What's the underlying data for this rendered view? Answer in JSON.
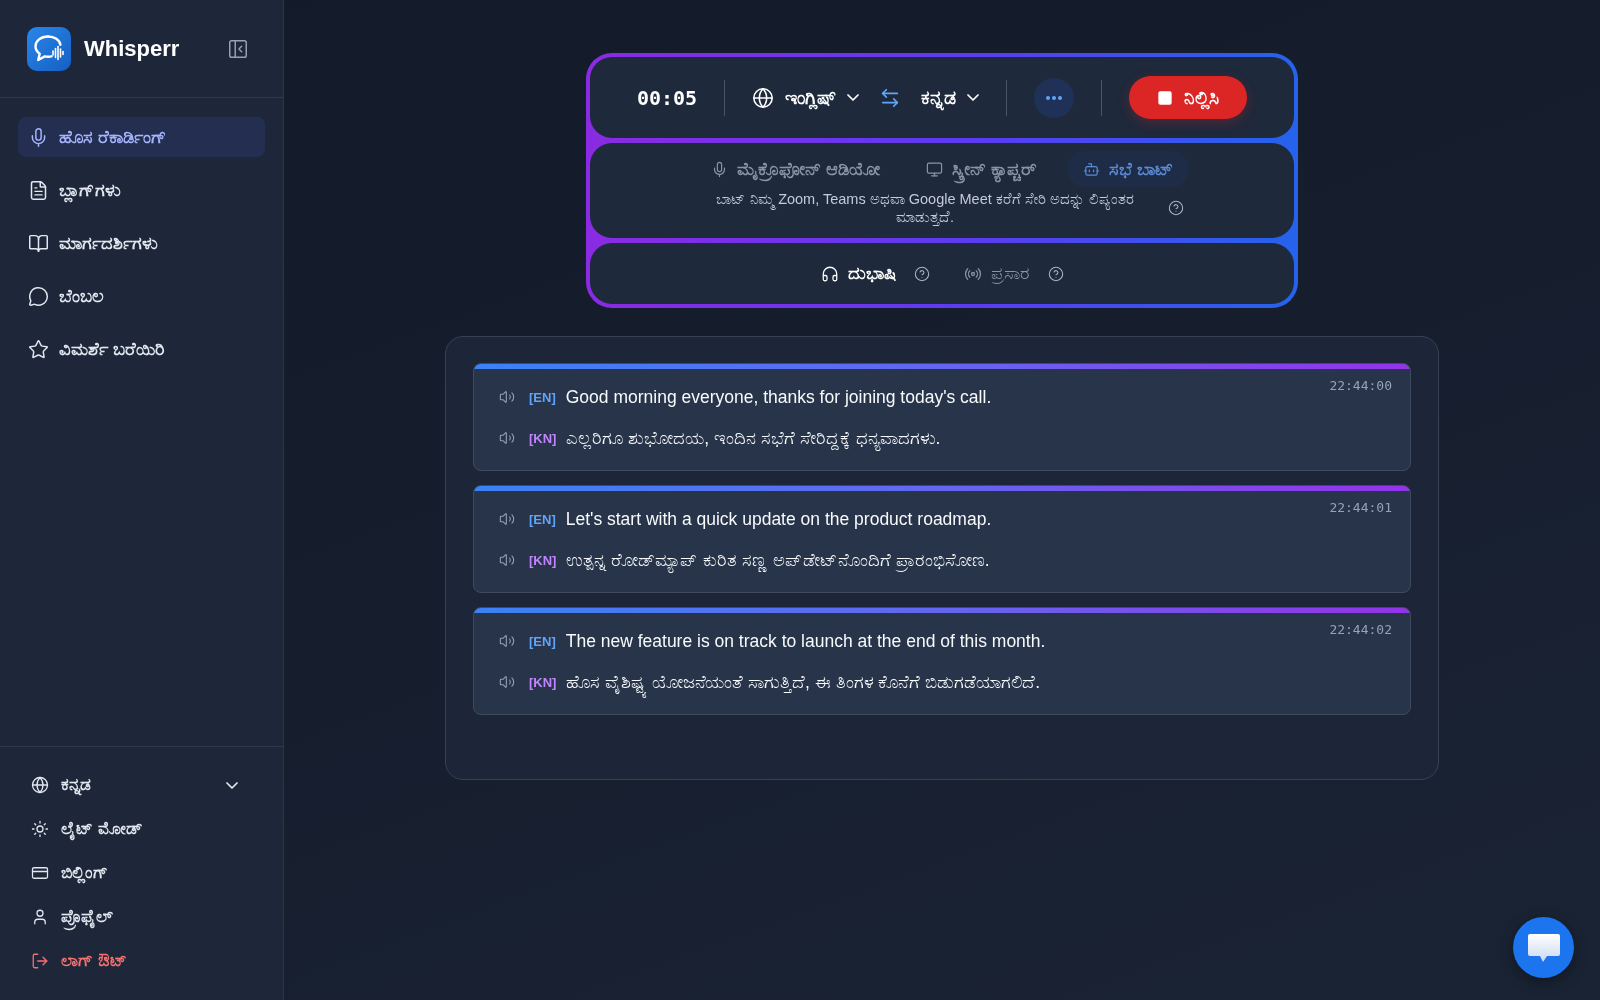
{
  "sidebar": {
    "brand": "Whisperr",
    "nav_items": [
      {
        "label": "ಹೊಸ ರೆಕಾರ್ಡಿಂಗ್",
        "selected": true
      },
      {
        "label": "ಬ್ಲಾಗ್‌ಗಳು",
        "selected": false
      },
      {
        "label": "ಮಾರ್ಗದರ್ಶಿಗಳು",
        "selected": false
      },
      {
        "label": "ಬೆಂಬಲ",
        "selected": false
      },
      {
        "label": "ವಿಮರ್ಶೆ ಬರೆಯಿರಿ",
        "selected": false
      }
    ],
    "footer_items": [
      {
        "label": "ಕನ್ನಡ",
        "kind": "dropdown"
      },
      {
        "label": "ಲೈಟ್ ಮೋಡ್",
        "kind": "link"
      },
      {
        "label": "ಬಿಲ್ಲಿಂಗ್",
        "kind": "link"
      },
      {
        "label": "ಪ್ರೊಫೈಲ್",
        "kind": "link"
      },
      {
        "label": "ಲಾಗ್ ಔಟ್",
        "kind": "danger"
      }
    ]
  },
  "recorder": {
    "timer": "00:05",
    "source_language": "ಇಂಗ್ಲಿಷ್",
    "target_language": "ಕನ್ನಡ",
    "stop_button": "ನಿಲ್ಲಿಸಿ",
    "input_modes": [
      {
        "label": "ಮೈಕ್ರೊಫೋನ್ ಆಡಿಯೋ",
        "selected": false
      },
      {
        "label": "ಸ್ಕ್ರೀನ್ ಕ್ಯಾಪ್ಚರ್",
        "selected": false
      },
      {
        "label": "ಸಭೆ ಬಾಟ್",
        "selected": true
      }
    ],
    "mode_description": "ಬಾಟ್ ನಿಮ್ಮ Zoom, Teams ಅಥವಾ Google Meet ಕರೆಗೆ ಸೇರಿ ಅದನ್ನು ಲಿಪ್ಯಂತರ ಮಾಡುತ್ತದೆ.",
    "output_modes": [
      {
        "label": "ದುಭಾಷಿ",
        "selected": true
      },
      {
        "label": "ಪ್ರಸಾರ",
        "selected": false
      }
    ]
  },
  "transcript": {
    "entries": [
      {
        "time": "22:44:00",
        "lines": [
          {
            "kind": "source",
            "tag": "[EN]",
            "text": "Good morning everyone, thanks for joining today's call."
          },
          {
            "kind": "translation",
            "tag": "[KN]",
            "text": "ಎಲ್ಲರಿಗೂ ಶುಭೋದಯ, ಇಂದಿನ ಸಭೆಗೆ ಸೇರಿದ್ದಕ್ಕೆ ಧನ್ಯವಾದಗಳು."
          }
        ]
      },
      {
        "time": "22:44:01",
        "lines": [
          {
            "kind": "source",
            "tag": "[EN]",
            "text": "Let's start with a quick update on the product roadmap."
          },
          {
            "kind": "translation",
            "tag": "[KN]",
            "text": "ಉತ್ಪನ್ನ ರೋಡ್‌ಮ್ಯಾಪ್ ಕುರಿತ ಸಣ್ಣ ಅಪ್‌ಡೇಟ್‌ನೊಂದಿಗೆ ಪ್ರಾರಂಭಿಸೋಣ."
          }
        ]
      },
      {
        "time": "22:44:02",
        "lines": [
          {
            "kind": "source",
            "tag": "[EN]",
            "text": "The new feature is on track to launch at the end of this month."
          },
          {
            "kind": "translation",
            "tag": "[KN]",
            "text": "ಹೊಸ ವೈಶಿಷ್ಟ್ಯ ಯೋಜನೆಯಂತೆ ಸಾಗುತ್ತಿದೆ, ಈ ತಿಂಗಳ ಕೊನೆಗೆ ಬಿಡುಗಡೆಯಾಗಲಿದೆ."
          }
        ]
      }
    ]
  }
}
